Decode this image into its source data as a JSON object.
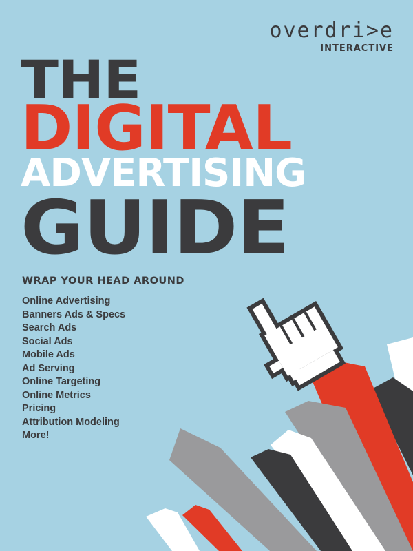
{
  "logo": {
    "main": "overdri>e",
    "sub": "INTERACTIVE"
  },
  "title": {
    "line1": "THE",
    "line2": "DIGITAL",
    "line3": "ADVERTISING",
    "line4": "GUIDE"
  },
  "subheading": "WRAP YOUR HEAD AROUND",
  "topics": [
    "Online Advertising",
    "Banners Ads & Specs",
    "Search Ads",
    "Social Ads",
    "Mobile Ads",
    "Ad Serving",
    "Online Targeting",
    "Online Metrics",
    "Pricing",
    "Attribution Modeling",
    "More!"
  ],
  "colors": {
    "background": "#a6d2e3",
    "dark": "#3b3b3d",
    "red": "#e13b26",
    "gray": "#9a9a9c",
    "white": "#ffffff"
  },
  "icons": [
    "pointing-hand-cursor-icon",
    "upward-arrows-graphic"
  ]
}
